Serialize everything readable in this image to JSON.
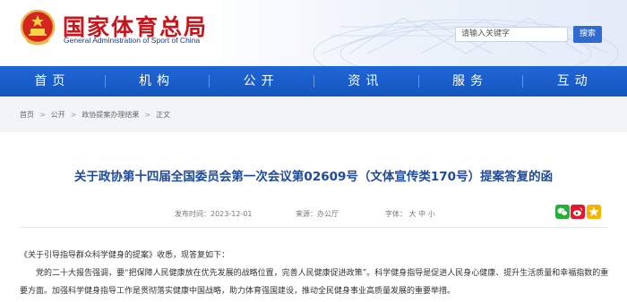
{
  "header": {
    "logo_cn": "国家体育总局",
    "logo_en": "General Administration of Sport of China",
    "search_placeholder": "请输入关键字",
    "search_button": "搜索"
  },
  "nav": {
    "items": [
      "首页",
      "机构",
      "公开",
      "资讯",
      "服务",
      "互动"
    ]
  },
  "breadcrumb": {
    "items": [
      "首页",
      "公开",
      "政协提案办理结果",
      "正文"
    ],
    "separator": ">"
  },
  "article": {
    "title": "关于政协第十四届全国委员会第一次会议第02609号（文体宣传类170号）提案答复的函",
    "date_label": "发布时间：",
    "date": "2023-12-01",
    "source_label": "来源：",
    "source": "办公厅",
    "font_label": "字体：",
    "font_sizes": [
      "大",
      "中",
      "小"
    ],
    "share_icons": [
      "wechat-icon",
      "weibo-icon",
      "qzone-icon"
    ],
    "paragraphs": [
      "《关于引导指导群众科学健身的提案》收悉，现答复如下：",
      "党的二十大报告强调，要“把保障人民健康放在优先发展的战略位置，完善人民健康促进政策”。科学健身指导是促进人民身心健康、提升生活质量和幸福指数的重要方面。加强科学健身指导工作是贯彻落实健康中国战略，助力体育强国建设，推动全民健身事业高质量发展的重要举措。"
    ]
  },
  "colors": {
    "nav_blue": "#1a5fcf",
    "title_blue": "#1e4a9a",
    "logo_red": "#c4161c"
  }
}
